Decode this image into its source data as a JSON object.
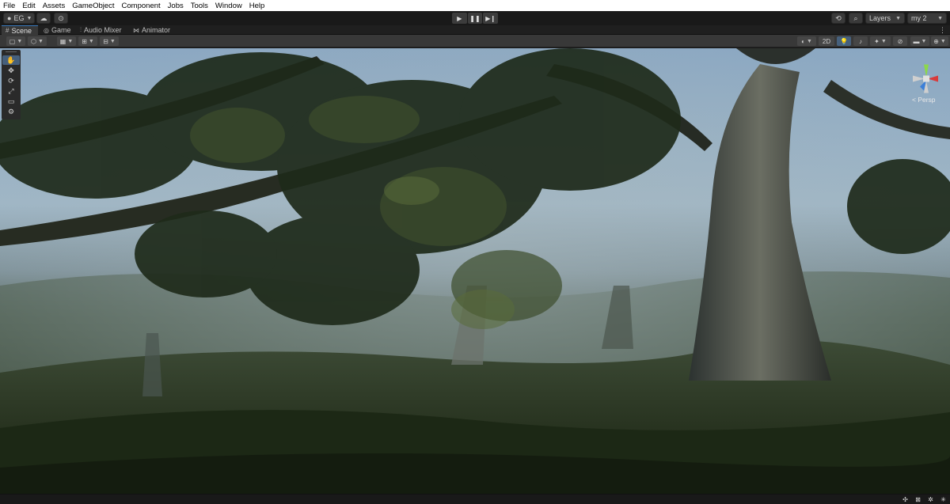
{
  "menu": [
    "File",
    "Edit",
    "Assets",
    "GameObject",
    "Component",
    "Jobs",
    "Tools",
    "Window",
    "Help"
  ],
  "toolbar": {
    "account_label": "EG",
    "play_icon": "play-icon",
    "pause_icon": "pause-icon",
    "step_icon": "step-icon",
    "layers_label": "Layers",
    "layout_label": "my 2"
  },
  "tabs": [
    {
      "label": "Scene",
      "icon": "scene-icon",
      "active": true
    },
    {
      "label": "Game",
      "icon": "game-icon",
      "active": false
    },
    {
      "label": "Audio Mixer",
      "icon": "audio-mixer-icon",
      "active": false
    },
    {
      "label": "Animator",
      "icon": "animator-icon",
      "active": false
    }
  ],
  "scene_toolbar": {
    "mode_2d_label": "2D"
  },
  "tools": [
    "hand-tool",
    "move-tool",
    "rotate-tool",
    "scale-tool",
    "rect-tool",
    "transform-tool"
  ],
  "gizmo": {
    "projection_label": "< Persp",
    "axis_colors": {
      "x": "#d83b3b",
      "y": "#8cd84a",
      "z": "#3b7fd8"
    }
  },
  "colors": {
    "accent": "#3a79bb",
    "menubar": "#ffffff",
    "panel": "#383838"
  }
}
